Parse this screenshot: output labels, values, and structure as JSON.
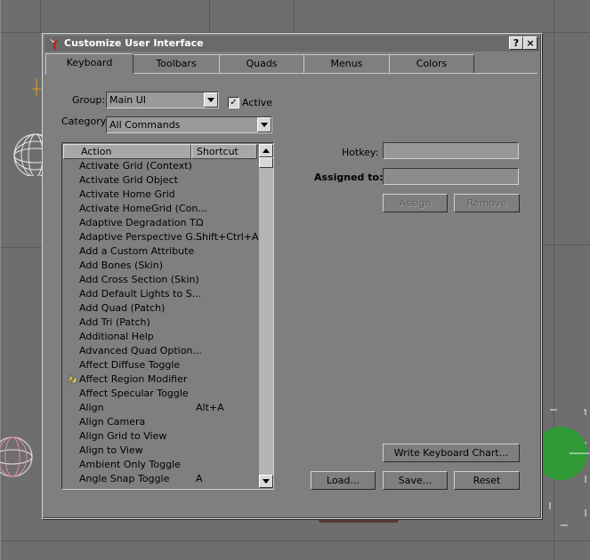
{
  "dialog": {
    "title": "Customize User Interface",
    "help_button": "?",
    "close_button": "×"
  },
  "tabs": [
    "Keyboard",
    "Toolbars",
    "Quads",
    "Menus",
    "Colors"
  ],
  "active_tab": "Keyboard",
  "group": {
    "label": "Group:",
    "value": "Main UI"
  },
  "active_checkbox": {
    "label": "Active",
    "checked": true,
    "mark": "✓"
  },
  "category": {
    "label": "Category:",
    "value": "All Commands"
  },
  "action_list": {
    "headers": {
      "action": "Action",
      "shortcut": "Shortcut"
    },
    "rows": [
      {
        "action": "Activate Grid (Context)",
        "shortcut": ""
      },
      {
        "action": "Activate Grid Object",
        "shortcut": ""
      },
      {
        "action": "Activate Home Grid",
        "shortcut": ""
      },
      {
        "action": "Activate HomeGrid (Con...",
        "shortcut": ""
      },
      {
        "action": "Adaptive Degradation T...",
        "shortcut": "O"
      },
      {
        "action": "Adaptive Perspective G...",
        "shortcut": "Shift+Ctrl+A"
      },
      {
        "action": "Add a Custom Attribute",
        "shortcut": ""
      },
      {
        "action": "Add Bones (Skin)",
        "shortcut": ""
      },
      {
        "action": "Add Cross Section (Skin)",
        "shortcut": ""
      },
      {
        "action": "Add Default Lights to S...",
        "shortcut": ""
      },
      {
        "action": "Add Quad (Patch)",
        "shortcut": ""
      },
      {
        "action": "Add Tri (Patch)",
        "shortcut": ""
      },
      {
        "action": "Additional Help",
        "shortcut": ""
      },
      {
        "action": "Advanced Quad Option...",
        "shortcut": ""
      },
      {
        "action": "Affect Diffuse Toggle",
        "shortcut": ""
      },
      {
        "action": "Affect Region Modifier",
        "shortcut": "",
        "icon": "affect-region-icon"
      },
      {
        "action": "Affect Specular Toggle",
        "shortcut": ""
      },
      {
        "action": "Align",
        "shortcut": "Alt+A"
      },
      {
        "action": "Align Camera",
        "shortcut": ""
      },
      {
        "action": "Align Grid to View",
        "shortcut": ""
      },
      {
        "action": "Align to View",
        "shortcut": ""
      },
      {
        "action": "Ambient Only Toggle",
        "shortcut": ""
      },
      {
        "action": "Angle Snap Toggle",
        "shortcut": "A"
      }
    ]
  },
  "hotkey": {
    "label": "Hotkey:",
    "value": ""
  },
  "assigned_to": {
    "label": "Assigned to:",
    "value": ""
  },
  "buttons": {
    "assign": "Assign",
    "remove": "Remove",
    "write_keyboard_chart": "Write Keyboard Chart...",
    "load": "Load...",
    "save": "Save...",
    "reset": "Reset"
  },
  "colors": {
    "dialog_bg": "#7f7f7f",
    "titlebar": "#6a6a6a",
    "viewport": "#6e6e6e",
    "green_sphere": "#2f9a36"
  }
}
